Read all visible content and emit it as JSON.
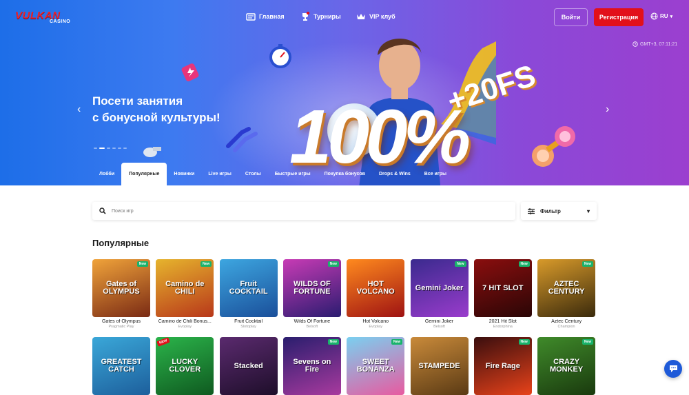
{
  "header": {
    "logo_top": "VULKAN",
    "logo_bottom": "CASINO",
    "nav": [
      {
        "label": "Главная",
        "icon": "home-icon"
      },
      {
        "label": "Турниры",
        "icon": "trophy-icon"
      },
      {
        "label": "VIP клуб",
        "icon": "crown-icon"
      }
    ],
    "login_label": "Войти",
    "register_label": "Регистрация",
    "lang": "RU",
    "time": "GMT+3, 07:11:21"
  },
  "banner": {
    "title_line1": "Посети занятия",
    "title_line2": "с бонусной культуры!",
    "big_text": "100%",
    "fs_text": "+20FS",
    "prev": "‹",
    "next": "›"
  },
  "tabs": [
    "Лобби",
    "Популярные",
    "Новинки",
    "Live игры",
    "Столы",
    "Быстрые игры",
    "Покупка бонусов",
    "Drops & Wins",
    "Все игры"
  ],
  "active_tab": "Популярные",
  "search": {
    "placeholder": "Поиск игр"
  },
  "filter": {
    "label": "Фильтр"
  },
  "section_title": "Популярные",
  "games": [
    {
      "name": "Gates of Olympus",
      "provider": "Pragmatic Play",
      "thumb": "Gates of OLYMPUS",
      "badge": "New",
      "bg": "linear-gradient(160deg,#f0a33a,#7a2a14)"
    },
    {
      "name": "Camino de Chili Bonus...",
      "provider": "Evoplay",
      "thumb": "Camino de CHILI",
      "badge": "New",
      "bg": "linear-gradient(160deg,#e6b42d,#b8371a)"
    },
    {
      "name": "Fruit Cocktail",
      "provider": "Slotoplay",
      "thumb": "Fruit COCKTAIL",
      "badge": "",
      "bg": "linear-gradient(160deg,#3da6e0,#1a4f9a)"
    },
    {
      "name": "Wilds Of Fortune",
      "provider": "Belsoft",
      "thumb": "WILDS OF FORTUNE",
      "badge": "New",
      "bg": "linear-gradient(160deg,#c83bb5,#2a1c70)"
    },
    {
      "name": "Hot Volcano",
      "provider": "Evoplay",
      "thumb": "HOT VOLCANO",
      "badge": "",
      "bg": "linear-gradient(160deg,#ff8a1e,#9e1212)"
    },
    {
      "name": "Gemini Joker",
      "provider": "Belsoft",
      "thumb": "Gemini Joker",
      "badge": "New",
      "bg": "linear-gradient(160deg,#3a2a8e,#9a3ccc)"
    },
    {
      "name": "2021 Hit Slot",
      "provider": "Endorphina",
      "thumb": "7 HIT SLOT",
      "badge": "New",
      "bg": "linear-gradient(160deg,#8a0e0e,#2a0606)"
    },
    {
      "name": "Aztec Century",
      "provider": "Champion",
      "thumb": "AZTEC CENTURY",
      "badge": "New",
      "bg": "linear-gradient(160deg,#d89a2a,#3a2a0c)"
    },
    {
      "name": "The Greatest Catch",
      "provider": "",
      "thumb": "GREATEST CATCH",
      "badge": "",
      "bg": "linear-gradient(160deg,#3aa7d8,#1d5f9c)"
    },
    {
      "name": "Lucky Clover",
      "provider": "",
      "thumb": "LUCKY CLOVER",
      "badge": "NEW",
      "bg": "linear-gradient(160deg,#2bb34a,#0f5a20)"
    },
    {
      "name": "Stacked",
      "provider": "",
      "thumb": "Stacked",
      "badge": "",
      "bg": "linear-gradient(160deg,#5a2a6e,#1e0e2a)"
    },
    {
      "name": "Sevens on Fire",
      "provider": "",
      "thumb": "Sevens on Fire",
      "badge": "New",
      "bg": "linear-gradient(160deg,#2a1e6e,#a83a9e)"
    },
    {
      "name": "Sweet Bonanza",
      "provider": "",
      "thumb": "SWEET BONANZA",
      "badge": "New",
      "bg": "linear-gradient(160deg,#7ad0f0,#e85aa0)"
    },
    {
      "name": "Stampede",
      "provider": "",
      "thumb": "STAMPEDE",
      "badge": "",
      "bg": "linear-gradient(160deg,#c98a3a,#5a3a14)"
    },
    {
      "name": "Fire Rage",
      "provider": "",
      "thumb": "Fire Rage",
      "badge": "New",
      "bg": "linear-gradient(160deg,#3a0e0e,#e8421a)"
    },
    {
      "name": "Crazy Monkey",
      "provider": "",
      "thumb": "CRAZY MONKEY",
      "badge": "New",
      "bg": "linear-gradient(160deg,#3f8a2a,#1a3a0e)"
    }
  ],
  "colors": {
    "accent": "#e2101a",
    "badge": "#19b36b",
    "chat": "#1e5ad8"
  }
}
